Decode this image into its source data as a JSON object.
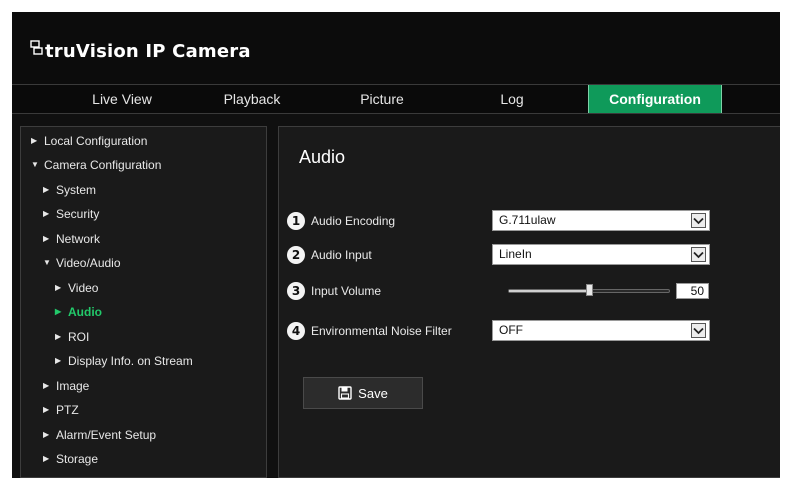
{
  "header": {
    "logo_text": "truVision IP Camera",
    "logo_icon": "camera-outline-icon"
  },
  "nav": {
    "tabs": [
      {
        "label": "Live View",
        "active": false
      },
      {
        "label": "Playback",
        "active": false
      },
      {
        "label": "Picture",
        "active": false
      },
      {
        "label": "Log",
        "active": false
      },
      {
        "label": "Configuration",
        "active": true
      }
    ]
  },
  "sidebar": {
    "items": [
      {
        "label": "Local Configuration",
        "arrow": "▶",
        "level": 0,
        "selected": false
      },
      {
        "label": "Camera Configuration",
        "arrow": "▼",
        "level": 0,
        "selected": false
      },
      {
        "label": "System",
        "arrow": "▶",
        "level": 1,
        "selected": false
      },
      {
        "label": "Security",
        "arrow": "▶",
        "level": 1,
        "selected": false
      },
      {
        "label": "Network",
        "arrow": "▶",
        "level": 1,
        "selected": false
      },
      {
        "label": "Video/Audio",
        "arrow": "▼",
        "level": 1,
        "selected": false
      },
      {
        "label": "Video",
        "arrow": "▶",
        "level": 2,
        "selected": false
      },
      {
        "label": "Audio",
        "arrow": "▶",
        "level": 2,
        "selected": true
      },
      {
        "label": "ROI",
        "arrow": "▶",
        "level": 2,
        "selected": false
      },
      {
        "label": "Display Info. on Stream",
        "arrow": "▶",
        "level": 2,
        "selected": false
      },
      {
        "label": "Image",
        "arrow": "▶",
        "level": 1,
        "selected": false
      },
      {
        "label": "PTZ",
        "arrow": "▶",
        "level": 1,
        "selected": false
      },
      {
        "label": "Alarm/Event Setup",
        "arrow": "▶",
        "level": 1,
        "selected": false
      },
      {
        "label": "Storage",
        "arrow": "▶",
        "level": 1,
        "selected": false
      }
    ]
  },
  "panel": {
    "title": "Audio",
    "audio_encoding": {
      "badge": "1",
      "label": "Audio Encoding",
      "value": "G.711ulaw"
    },
    "audio_input": {
      "badge": "2",
      "label": "Audio Input",
      "value": "LineIn"
    },
    "input_volume": {
      "badge": "3",
      "label": "Input Volume",
      "value": "50",
      "max": 100
    },
    "noise_filter": {
      "badge": "4",
      "label": "Environmental Noise Filter",
      "value": "OFF"
    },
    "save_label": "Save"
  },
  "colors": {
    "accent": "#0f9a5a",
    "selected_text": "#22c96a",
    "background": "#101010",
    "panel": "#1a1a1a"
  }
}
